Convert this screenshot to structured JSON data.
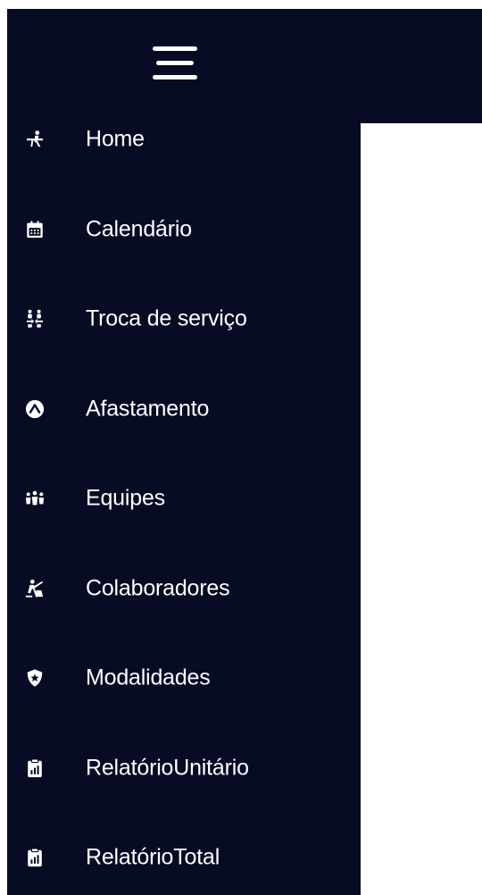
{
  "sidebar": {
    "menu_icon": "hamburger-menu-icon",
    "items": [
      {
        "label": "Home",
        "icon": "person-at-desk-icon"
      },
      {
        "label": "Calendário",
        "icon": "calendar-icon"
      },
      {
        "label": "Troca de serviço",
        "icon": "people-swap-icon"
      },
      {
        "label": "Afastamento",
        "icon": "circle-caret-up-icon"
      },
      {
        "label": "Equipes",
        "icon": "people-group-icon"
      },
      {
        "label": "Colaboradores",
        "icon": "person-digging-icon"
      },
      {
        "label": "Modalidades",
        "icon": "shield-star-icon"
      },
      {
        "label": "RelatórioUnitário",
        "icon": "clipboard-chart-icon"
      },
      {
        "label": "RelatórioTotal",
        "icon": "clipboard-chart-icon"
      }
    ]
  },
  "colors": {
    "sidebar_bg": "#070b24",
    "text": "#ffffff",
    "content_bg": "#ffffff"
  }
}
